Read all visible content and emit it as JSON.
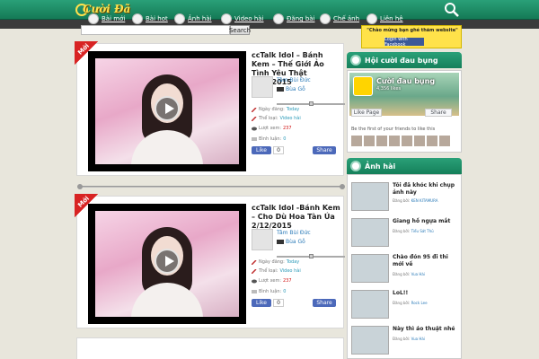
{
  "header": {
    "logo_text": "Cười Đã",
    "search_icon": "search-icon"
  },
  "nav": {
    "items": [
      {
        "label": "Bài mới",
        "icon": "home-icon"
      },
      {
        "label": "Bài hot",
        "icon": "fire-icon"
      },
      {
        "label": "Ảnh hài",
        "icon": "image-icon"
      },
      {
        "label": "Video hài",
        "icon": "video-icon"
      },
      {
        "label": "Đăng bài",
        "icon": "upload-icon"
      },
      {
        "label": "Chế ảnh",
        "icon": "edit-icon"
      },
      {
        "label": "Liên hệ",
        "icon": "mail-icon"
      }
    ]
  },
  "search": {
    "placeholder": "",
    "button_label": "Search"
  },
  "posts": [
    {
      "badge": "Mới",
      "title": "ccTalk Idol – Bánh Kem – Thế Giới Ảo Tình Yêu Thật 2/12/2015",
      "author": "Tâm Bùi Đức",
      "rank": "Bùa Gỗ",
      "date_label": "Ngày đăng:",
      "date_value": "Today",
      "category_label": "Thể loại:",
      "category_value": "Video hài",
      "views_label": "Lượt xem:",
      "views_value": "237",
      "comments_label": "Bình luận:",
      "comments_value": "0",
      "like_label": "Like",
      "like_count": "0",
      "share_label": "Share"
    },
    {
      "badge": "Mới",
      "title": "ccTalk Idol -Bánh Kem – Cho Dù Hoa Tàn Úa 2/12/2015",
      "author": "Tâm Bùi Đức",
      "rank": "Bùa Gỗ",
      "date_label": "Ngày đăng:",
      "date_value": "Today",
      "category_label": "Thể loại:",
      "category_value": "Video hài",
      "views_label": "Lượt xem:",
      "views_value": "237",
      "comments_label": "Bình luận:",
      "comments_value": "0",
      "like_label": "Like",
      "like_count": "0",
      "share_label": "Share"
    }
  ],
  "sidebar": {
    "welcome_text": "\"Chào mừng bạn ghé thăm website\"",
    "fb_login_label": "Login with Facebook",
    "widget1_title": "Hội cười đau bụng",
    "fbpage": {
      "name": "Cười đau bụng",
      "likes": "4,356 likes",
      "like_label": "Like Page",
      "share_label": "Share",
      "friends_text": "Be the first of your friends to like this"
    },
    "widget2_title": "Ảnh hài",
    "list": [
      {
        "title": "Tôi đã khóc khi chụp ảnh này",
        "by_label": "Đăng bởi:",
        "by": "KEN KITAMURA"
      },
      {
        "title": "Giang hồ ngựa mắt",
        "by_label": "Đăng bởi:",
        "by": "Tiểu Sát Thủ"
      },
      {
        "title": "Chào đón 95 đi thi mới về",
        "by_label": "Đăng bởi:",
        "by": "Vua Hài"
      },
      {
        "title": "LoL!!",
        "by_label": "Đăng bởi:",
        "by": "Rock Lee"
      },
      {
        "title": "Này thì áo thuật nhé",
        "by_label": "Đăng bởi:",
        "by": "Vua Hài"
      }
    ]
  },
  "colors": {
    "header_green": "#15805a",
    "badge_red": "#d82323",
    "welcome_yellow": "#ffe24a",
    "facebook_blue": "#3b5998"
  }
}
